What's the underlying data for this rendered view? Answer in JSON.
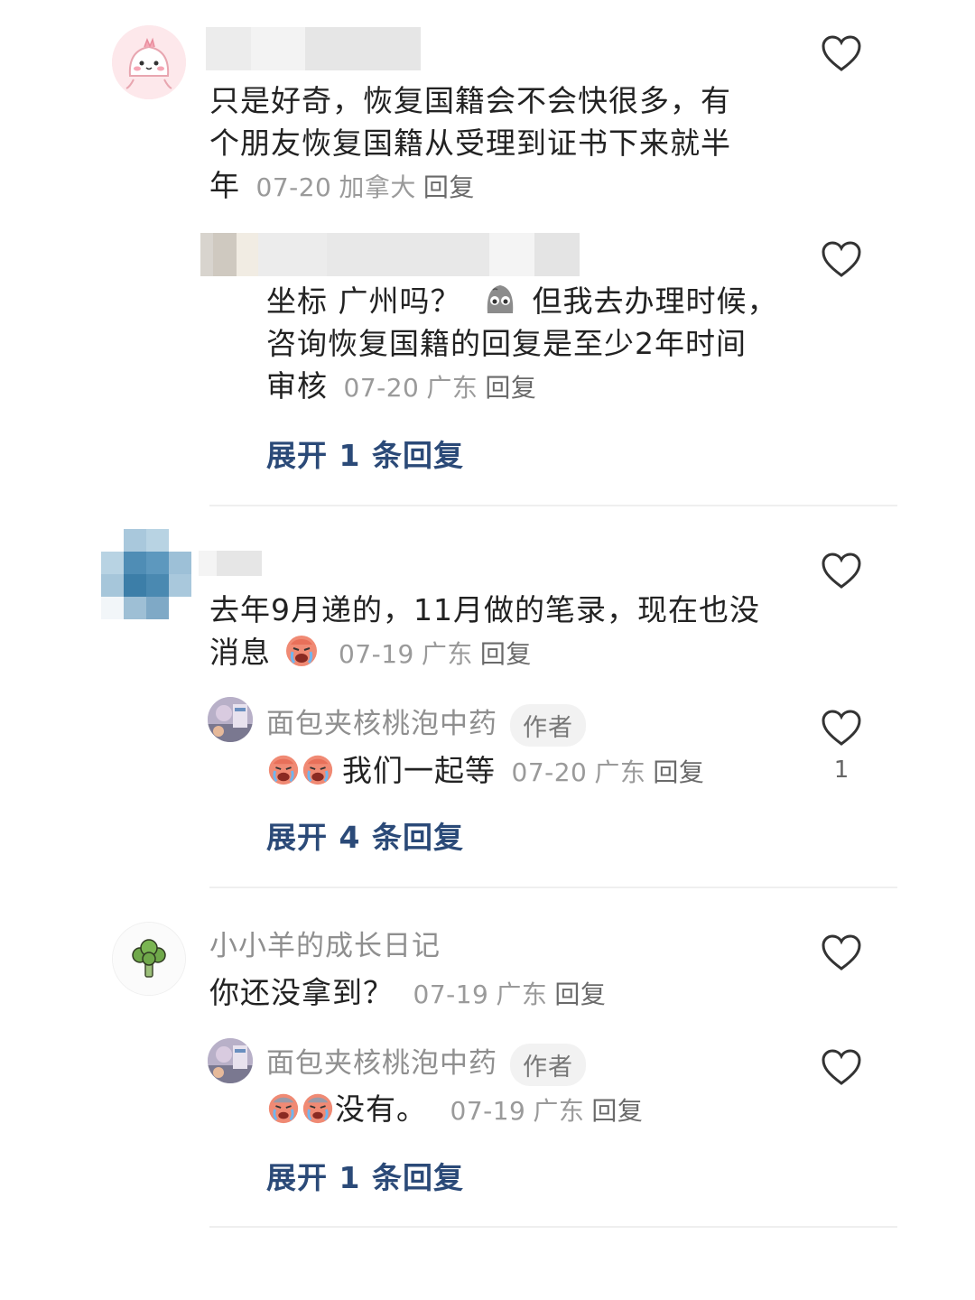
{
  "comments": [
    {
      "text": "只是好奇，恢复国籍会不会快很多，有个朋友恢复国籍从受理到证书下来就半年",
      "line1": "只是好奇，恢复国籍会不会快很多，有",
      "line2": "个朋友恢复国籍从受理到证书下来就半",
      "line3": "年",
      "date": "07-20",
      "location": "加拿大",
      "reply_label": "回复",
      "replies": [
        {
          "line1_a": "坐标 广州吗？",
          "line1_b": "但我去办理时候，",
          "line2": "咨询恢复国籍的回复是至少2年时间",
          "line3": "审核",
          "date": "07-20",
          "location": "广东",
          "reply_label": "回复"
        }
      ],
      "expand_label": "展开 1 条回复"
    },
    {
      "line1": "去年9月递的，11月做的笔录，现在也没",
      "line2": "消息",
      "date": "07-19",
      "location": "广东",
      "reply_label": "回复",
      "replies": [
        {
          "author": "面包夹核桃泡中药",
          "author_tag": "作者",
          "text": "我们一起等",
          "date": "07-20",
          "location": "广东",
          "reply_label": "回复",
          "likes": "1"
        }
      ],
      "expand_label": "展开 4 条回复"
    },
    {
      "author": "小小羊的成长日记",
      "text": "你还没拿到？",
      "date": "07-19",
      "location": "广东",
      "reply_label": "回复",
      "replies": [
        {
          "author": "面包夹核桃泡中药",
          "author_tag": "作者",
          "text": "没有。",
          "date": "07-19",
          "location": "广东",
          "reply_label": "回复"
        }
      ],
      "expand_label": "展开 1 条回复"
    }
  ],
  "icons": {
    "like": "heart-outline-icon",
    "emoji_cry": "crying-face-emoji",
    "emoji_ghost": "gray-ghost-emoji"
  },
  "colors": {
    "expand_link": "#2b4a78",
    "meta_text": "#9a9a9a",
    "main_text": "#222222"
  }
}
